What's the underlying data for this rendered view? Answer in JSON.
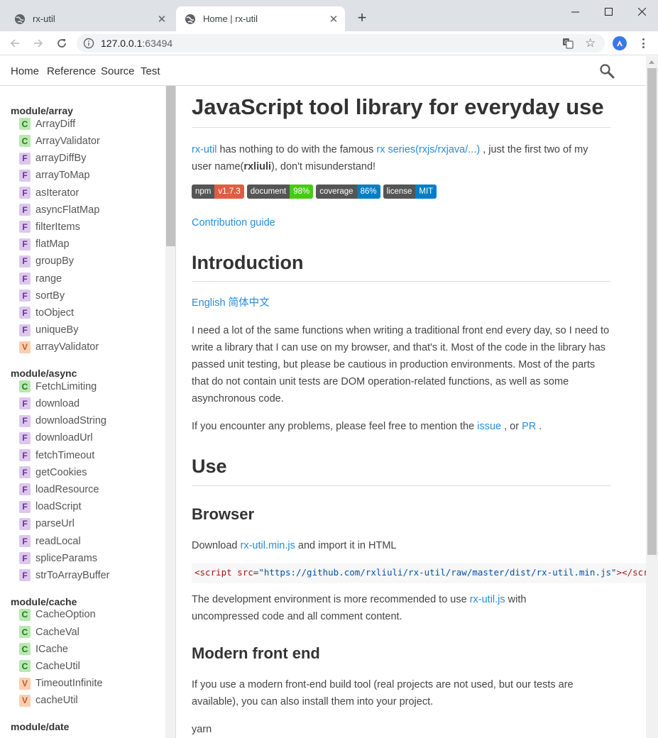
{
  "browser": {
    "tabs": [
      {
        "title": "rx-util",
        "active": false
      },
      {
        "title": "Home | rx-util",
        "active": true
      }
    ],
    "url_host": "127.0.0.1",
    "url_port": ":63494"
  },
  "topnav": {
    "links": [
      "Home",
      "Reference",
      "Source",
      "Test"
    ]
  },
  "sidebar": {
    "groups": [
      {
        "title": "module/array",
        "items": [
          {
            "badge": "C",
            "label": "ArrayDiff"
          },
          {
            "badge": "C",
            "label": "ArrayValidator"
          },
          {
            "badge": "F",
            "label": "arrayDiffBy"
          },
          {
            "badge": "F",
            "label": "arrayToMap"
          },
          {
            "badge": "F",
            "label": "asIterator"
          },
          {
            "badge": "F",
            "label": "asyncFlatMap"
          },
          {
            "badge": "F",
            "label": "filterItems"
          },
          {
            "badge": "F",
            "label": "flatMap"
          },
          {
            "badge": "F",
            "label": "groupBy"
          },
          {
            "badge": "F",
            "label": "range"
          },
          {
            "badge": "F",
            "label": "sortBy"
          },
          {
            "badge": "F",
            "label": "toObject"
          },
          {
            "badge": "F",
            "label": "uniqueBy"
          },
          {
            "badge": "V",
            "label": "arrayValidator"
          }
        ]
      },
      {
        "title": "module/async",
        "items": [
          {
            "badge": "C",
            "label": "FetchLimiting"
          },
          {
            "badge": "F",
            "label": "download"
          },
          {
            "badge": "F",
            "label": "downloadString"
          },
          {
            "badge": "F",
            "label": "downloadUrl"
          },
          {
            "badge": "F",
            "label": "fetchTimeout"
          },
          {
            "badge": "F",
            "label": "getCookies"
          },
          {
            "badge": "F",
            "label": "loadResource"
          },
          {
            "badge": "F",
            "label": "loadScript"
          },
          {
            "badge": "F",
            "label": "parseUrl"
          },
          {
            "badge": "F",
            "label": "readLocal"
          },
          {
            "badge": "F",
            "label": "spliceParams"
          },
          {
            "badge": "F",
            "label": "strToArrayBuffer"
          }
        ]
      },
      {
        "title": "module/cache",
        "items": [
          {
            "badge": "C",
            "label": "CacheOption"
          },
          {
            "badge": "C",
            "label": "CacheVal"
          },
          {
            "badge": "C",
            "label": "ICache"
          },
          {
            "badge": "C",
            "label": "CacheUtil"
          },
          {
            "badge": "V",
            "label": "TimeoutInfinite"
          },
          {
            "badge": "V",
            "label": "cacheUtil"
          }
        ]
      },
      {
        "title": "module/date",
        "items": []
      }
    ]
  },
  "content": {
    "title": "JavaScript tool library for everyday use",
    "intro": {
      "link1": "rx-util",
      "text1": " has nothing to do with the famous ",
      "link2": "rx series(rxjs/rxjava/...)",
      "text2": " , just the first two of my user name(",
      "bold": "rxliuli",
      "text3": "), don't misunderstand!"
    },
    "shields": [
      {
        "label": "npm",
        "value": "v1.7.3",
        "color": "#e05d44"
      },
      {
        "label": "document",
        "value": "98%",
        "color": "#4c1"
      },
      {
        "label": "coverage",
        "value": "86%",
        "color": "#007ec6"
      },
      {
        "label": "license",
        "value": "MIT",
        "color": "#007ec6"
      }
    ],
    "contribution_link": "Contribution guide",
    "introduction_heading": "Introduction",
    "lang_en": "English",
    "lang_zh": "简体中文",
    "intro_paragraph": "I need a lot of the same functions when writing a traditional front end every day, so I need to write a library that I can use on my browser, and that's it. Most of the code in the library has passed unit testing, but please be cautious in production environments. Most of the parts that do not contain unit tests are DOM operation-related functions, as well as some asynchronous code.",
    "problems": {
      "text1": "If you encounter any problems, please feel free to mention the ",
      "link1": "issue",
      "text2": " , or ",
      "link2": "PR",
      "text3": " ."
    },
    "use_heading": "Use",
    "browser_heading": "Browser",
    "download": {
      "text1": "Download ",
      "link": "rx-util.min.js",
      "text2": " and import it in HTML"
    },
    "code": {
      "open": "<script",
      "attr": " src",
      "eq": "=",
      "value": "\"https://github.com/rxliuli/rx-util/raw/master/dist/rx-util.min.js\"",
      "close": "></scr"
    },
    "dev_env": {
      "text1": "The development environment is more recommended to use ",
      "link": "rx-util.js",
      "text2": " with uncompressed code and all comment content."
    },
    "modern_heading": "Modern front end",
    "modern_paragraph": "If you use a modern front-end build tool (real projects are not used, but our tests are available), you can also install them into your project.",
    "yarn": "yarn"
  }
}
